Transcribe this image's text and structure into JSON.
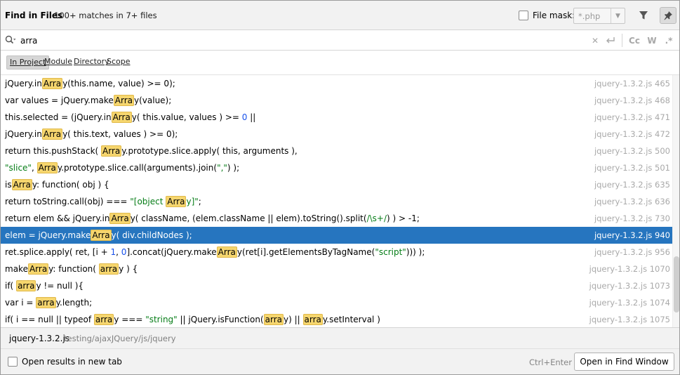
{
  "header": {
    "title": "Find in Files",
    "matches": "100+ matches in 7+ files",
    "file_mask_label": "File mask:",
    "file_mask_value": "*.php"
  },
  "search": {
    "query": "arra",
    "case_label": "Cc",
    "words_label": "W",
    "regex_label": ".*"
  },
  "scope": {
    "tabs": [
      "In Project",
      "Module",
      "Directory",
      "Scope"
    ],
    "active": "In Project"
  },
  "results": [
    {
      "file": "jquery-1.3.2.js 465"
    },
    {
      "file": "jquery-1.3.2.js 468"
    },
    {
      "file": "jquery-1.3.2.js 471"
    },
    {
      "file": "jquery-1.3.2.js 472"
    },
    {
      "file": "jquery-1.3.2.js 500"
    },
    {
      "file": "jquery-1.3.2.js 501"
    },
    {
      "file": "jquery-1.3.2.js 635"
    },
    {
      "file": "jquery-1.3.2.js 636"
    },
    {
      "file": "jquery-1.3.2.js 730"
    },
    {
      "file": "jquery-1.3.2.js 940"
    },
    {
      "file": "jquery-1.3.2.js 956"
    },
    {
      "file": "jquery-1.3.2.js 1070"
    },
    {
      "file": "jquery-1.3.2.js 1073"
    },
    {
      "file": "jquery-1.3.2.js 1074"
    },
    {
      "file": "jquery-1.3.2.js 1075"
    }
  ],
  "code": {
    "r0": {
      "a": "jQuery.in",
      "h": "Arra",
      "b": "y(this.name, value) >= 0);"
    },
    "r1": {
      "a": "var values = jQuery.make",
      "h": "Arra",
      "b": "y(value);"
    },
    "r2": {
      "a": "this.selected = (jQuery.in",
      "h": "Arra",
      "b": "y( this.value, values ) >= ",
      "n": "0",
      "c": " ||"
    },
    "r3": {
      "a": "jQuery.in",
      "h": "Arra",
      "b": "y( this.text, values ) >= 0);"
    },
    "r4": {
      "a": "return this.pushStack( ",
      "h": "Arra",
      "b": "y.prototype.slice.apply( this, arguments ),"
    },
    "r5": {
      "s1": "\"slice\"",
      "a": ", ",
      "h": "Arra",
      "b": "y.prototype.slice.call(arguments).join(",
      "s2": "\",\"",
      "c": ") );"
    },
    "r6": {
      "a": "is",
      "h": "Arra",
      "b": "y: function( obj ) {"
    },
    "r7": {
      "a": "return toString.call(obj) === ",
      "s1": "\"[object ",
      "h": "Arra",
      "s2": "y]\"",
      "c": ";"
    },
    "r8": {
      "a": "return elem && jQuery.in",
      "h": "Arra",
      "b": "y( className, (elem.className || elem).toString().split(",
      "s1": "/\\s+/",
      "c": ") ) > -1;"
    },
    "r9": {
      "a": "elem = jQuery.make",
      "h": "Arra",
      "b": "y( div.childNodes );"
    },
    "r10": {
      "a": "ret.splice.apply( ret, [i + ",
      "n1": "1",
      "m": ", ",
      "n2": "0",
      "b": "].concat(jQuery.make",
      "h": "Arra",
      "c": "y(ret[i].getElementsByTagName(",
      "s1": "\"script\"",
      "d": "))) );"
    },
    "r11": {
      "a": "make",
      "h": "Arra",
      "b": "y: function( ",
      "h2": "arra",
      "c": "y ) {"
    },
    "r12": {
      "a": "if( ",
      "h": "arra",
      "b": "y != null ){"
    },
    "r13": {
      "a": "var i = ",
      "h": "arra",
      "b": "y.length;"
    },
    "r14": {
      "a": "if( i == null || typeof ",
      "h": "arra",
      "b": "y === ",
      "s1": "\"string\"",
      "c": " || jQuery.isFunction(",
      "h2": "arra",
      "d": "y) || ",
      "h3": "arra",
      "e": "y.setInterval )"
    }
  },
  "preview": {
    "file": "jquery-1.3.2.js",
    "path": "testing/ajaxJQuery/js/jquery"
  },
  "bottom": {
    "open_new_tab_label": "Open results in new tab",
    "shortcut": "Ctrl+Enter",
    "open_button": "Open in Find Window"
  }
}
